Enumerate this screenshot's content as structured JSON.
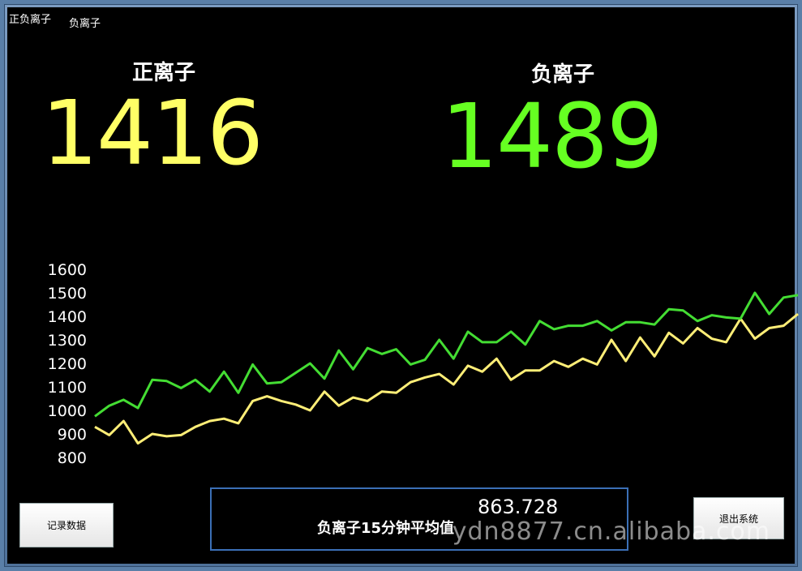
{
  "menu": {
    "item1": "正负离子",
    "item2": "负离子"
  },
  "positive": {
    "label": "正离子",
    "value": "1416",
    "color": "#ffff66"
  },
  "negative": {
    "label": "负离子",
    "value": "1489",
    "color": "#66ff22"
  },
  "chart_data": {
    "type": "line",
    "yticks": [
      "1600",
      "1500",
      "1400",
      "1300",
      "1200",
      "1100",
      "1000",
      "900",
      "800"
    ],
    "ylim": [
      800,
      1600
    ],
    "grid": false,
    "series": [
      {
        "color": "#ffee77",
        "values": [
          930,
          895,
          955,
          860,
          900,
          890,
          895,
          930,
          955,
          965,
          945,
          1040,
          1060,
          1040,
          1025,
          1000,
          1080,
          1020,
          1055,
          1040,
          1080,
          1075,
          1120,
          1140,
          1155,
          1110,
          1190,
          1165,
          1220,
          1130,
          1170,
          1170,
          1210,
          1185,
          1220,
          1195,
          1300,
          1210,
          1310,
          1230,
          1330,
          1285,
          1350,
          1305,
          1290,
          1390,
          1305,
          1350,
          1360,
          1410
        ]
      },
      {
        "color": "#44dd33",
        "values": [
          975,
          1020,
          1045,
          1010,
          1130,
          1125,
          1095,
          1130,
          1080,
          1165,
          1075,
          1195,
          1115,
          1120,
          1160,
          1200,
          1135,
          1255,
          1175,
          1265,
          1240,
          1260,
          1195,
          1215,
          1300,
          1220,
          1335,
          1290,
          1290,
          1335,
          1280,
          1380,
          1345,
          1360,
          1360,
          1380,
          1340,
          1375,
          1375,
          1365,
          1430,
          1425,
          1380,
          1405,
          1395,
          1390,
          1500,
          1410,
          1480,
          1490
        ]
      }
    ]
  },
  "record_button": "记录数据",
  "exit_button": "退出系统",
  "avg": {
    "label": "负离子15分钟平均值",
    "value": "863.728"
  },
  "watermark": "ydn8877.cn.alibaba.com"
}
